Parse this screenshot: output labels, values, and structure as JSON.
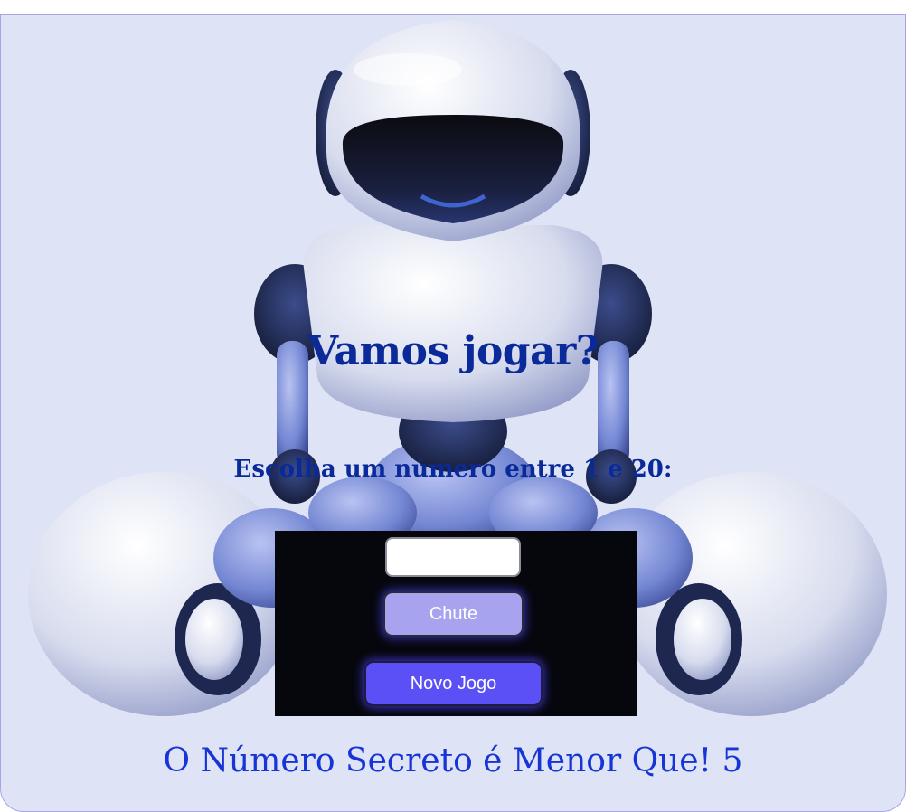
{
  "game": {
    "title": "Vamos jogar?",
    "instruction": "Escolha um número entre 1 e 20:",
    "guess_input_value": "",
    "guess_button_label": "Chute",
    "new_game_button_label": "Novo Jogo",
    "result_message": "O Número Secreto é Menor Que! 5"
  },
  "colors": {
    "background": "#dfe3f6",
    "heading": "#0b2a99",
    "message": "#1734d6",
    "guess_button": "#a7a3ef",
    "new_game_button": "#5a50f5"
  },
  "icons": {
    "illustration": "robot-illustration"
  }
}
